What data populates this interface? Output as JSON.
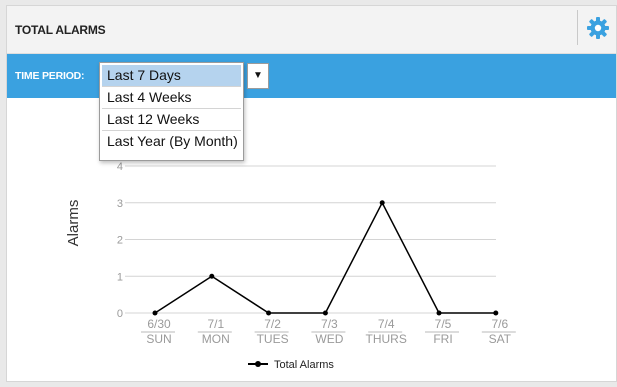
{
  "widget": {
    "title": "TOTAL ALARMS",
    "settings_icon": "gear-icon"
  },
  "toolbar": {
    "time_period_label": "TIME PERIOD:",
    "selected": "Last 7 Days",
    "options": [
      "Last 7 Days",
      "Last 4 Weeks",
      "Last 12 Weeks",
      "Last Year (By Month)"
    ]
  },
  "colors": {
    "toolbar_bg": "#3aa1e0",
    "gear": "#3aa1e0",
    "selected_option": "#b5d3ee",
    "series": "#000000"
  },
  "chart_data": {
    "type": "line",
    "ylabel": "Alarms",
    "ylim": [
      0,
      4
    ],
    "yticks": [
      0,
      1,
      2,
      3,
      4
    ],
    "grid": true,
    "categories": [
      {
        "date": "6/30",
        "day": "SUN"
      },
      {
        "date": "7/1",
        "day": "MON"
      },
      {
        "date": "7/2",
        "day": "TUES"
      },
      {
        "date": "7/3",
        "day": "WED"
      },
      {
        "date": "7/4",
        "day": "THURS"
      },
      {
        "date": "7/5",
        "day": "FRI"
      },
      {
        "date": "7/6",
        "day": "SAT"
      }
    ],
    "series": [
      {
        "name": "Total Alarms",
        "values": [
          0,
          1,
          0,
          0,
          3,
          0,
          0
        ]
      }
    ],
    "legend_position": "bottom"
  }
}
